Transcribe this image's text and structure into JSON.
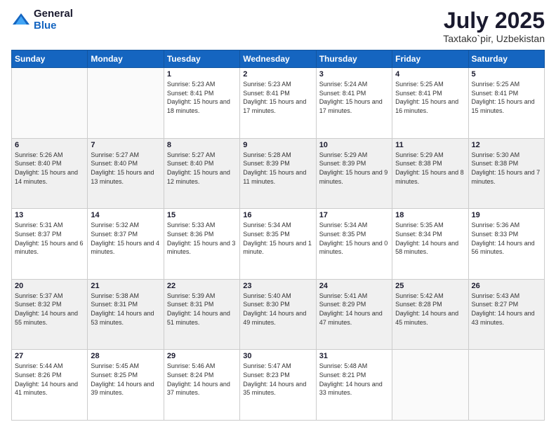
{
  "logo": {
    "general": "General",
    "blue": "Blue"
  },
  "title": "July 2025",
  "subtitle": "Taxtako`pir, Uzbekistan",
  "days_of_week": [
    "Sunday",
    "Monday",
    "Tuesday",
    "Wednesday",
    "Thursday",
    "Friday",
    "Saturday"
  ],
  "weeks": [
    [
      {
        "day": "",
        "sunrise": "",
        "sunset": "",
        "daylight": ""
      },
      {
        "day": "",
        "sunrise": "",
        "sunset": "",
        "daylight": ""
      },
      {
        "day": "1",
        "sunrise": "Sunrise: 5:23 AM",
        "sunset": "Sunset: 8:41 PM",
        "daylight": "Daylight: 15 hours and 18 minutes."
      },
      {
        "day": "2",
        "sunrise": "Sunrise: 5:23 AM",
        "sunset": "Sunset: 8:41 PM",
        "daylight": "Daylight: 15 hours and 17 minutes."
      },
      {
        "day": "3",
        "sunrise": "Sunrise: 5:24 AM",
        "sunset": "Sunset: 8:41 PM",
        "daylight": "Daylight: 15 hours and 17 minutes."
      },
      {
        "day": "4",
        "sunrise": "Sunrise: 5:25 AM",
        "sunset": "Sunset: 8:41 PM",
        "daylight": "Daylight: 15 hours and 16 minutes."
      },
      {
        "day": "5",
        "sunrise": "Sunrise: 5:25 AM",
        "sunset": "Sunset: 8:41 PM",
        "daylight": "Daylight: 15 hours and 15 minutes."
      }
    ],
    [
      {
        "day": "6",
        "sunrise": "Sunrise: 5:26 AM",
        "sunset": "Sunset: 8:40 PM",
        "daylight": "Daylight: 15 hours and 14 minutes."
      },
      {
        "day": "7",
        "sunrise": "Sunrise: 5:27 AM",
        "sunset": "Sunset: 8:40 PM",
        "daylight": "Daylight: 15 hours and 13 minutes."
      },
      {
        "day": "8",
        "sunrise": "Sunrise: 5:27 AM",
        "sunset": "Sunset: 8:40 PM",
        "daylight": "Daylight: 15 hours and 12 minutes."
      },
      {
        "day": "9",
        "sunrise": "Sunrise: 5:28 AM",
        "sunset": "Sunset: 8:39 PM",
        "daylight": "Daylight: 15 hours and 11 minutes."
      },
      {
        "day": "10",
        "sunrise": "Sunrise: 5:29 AM",
        "sunset": "Sunset: 8:39 PM",
        "daylight": "Daylight: 15 hours and 9 minutes."
      },
      {
        "day": "11",
        "sunrise": "Sunrise: 5:29 AM",
        "sunset": "Sunset: 8:38 PM",
        "daylight": "Daylight: 15 hours and 8 minutes."
      },
      {
        "day": "12",
        "sunrise": "Sunrise: 5:30 AM",
        "sunset": "Sunset: 8:38 PM",
        "daylight": "Daylight: 15 hours and 7 minutes."
      }
    ],
    [
      {
        "day": "13",
        "sunrise": "Sunrise: 5:31 AM",
        "sunset": "Sunset: 8:37 PM",
        "daylight": "Daylight: 15 hours and 6 minutes."
      },
      {
        "day": "14",
        "sunrise": "Sunrise: 5:32 AM",
        "sunset": "Sunset: 8:37 PM",
        "daylight": "Daylight: 15 hours and 4 minutes."
      },
      {
        "day": "15",
        "sunrise": "Sunrise: 5:33 AM",
        "sunset": "Sunset: 8:36 PM",
        "daylight": "Daylight: 15 hours and 3 minutes."
      },
      {
        "day": "16",
        "sunrise": "Sunrise: 5:34 AM",
        "sunset": "Sunset: 8:35 PM",
        "daylight": "Daylight: 15 hours and 1 minute."
      },
      {
        "day": "17",
        "sunrise": "Sunrise: 5:34 AM",
        "sunset": "Sunset: 8:35 PM",
        "daylight": "Daylight: 15 hours and 0 minutes."
      },
      {
        "day": "18",
        "sunrise": "Sunrise: 5:35 AM",
        "sunset": "Sunset: 8:34 PM",
        "daylight": "Daylight: 14 hours and 58 minutes."
      },
      {
        "day": "19",
        "sunrise": "Sunrise: 5:36 AM",
        "sunset": "Sunset: 8:33 PM",
        "daylight": "Daylight: 14 hours and 56 minutes."
      }
    ],
    [
      {
        "day": "20",
        "sunrise": "Sunrise: 5:37 AM",
        "sunset": "Sunset: 8:32 PM",
        "daylight": "Daylight: 14 hours and 55 minutes."
      },
      {
        "day": "21",
        "sunrise": "Sunrise: 5:38 AM",
        "sunset": "Sunset: 8:31 PM",
        "daylight": "Daylight: 14 hours and 53 minutes."
      },
      {
        "day": "22",
        "sunrise": "Sunrise: 5:39 AM",
        "sunset": "Sunset: 8:31 PM",
        "daylight": "Daylight: 14 hours and 51 minutes."
      },
      {
        "day": "23",
        "sunrise": "Sunrise: 5:40 AM",
        "sunset": "Sunset: 8:30 PM",
        "daylight": "Daylight: 14 hours and 49 minutes."
      },
      {
        "day": "24",
        "sunrise": "Sunrise: 5:41 AM",
        "sunset": "Sunset: 8:29 PM",
        "daylight": "Daylight: 14 hours and 47 minutes."
      },
      {
        "day": "25",
        "sunrise": "Sunrise: 5:42 AM",
        "sunset": "Sunset: 8:28 PM",
        "daylight": "Daylight: 14 hours and 45 minutes."
      },
      {
        "day": "26",
        "sunrise": "Sunrise: 5:43 AM",
        "sunset": "Sunset: 8:27 PM",
        "daylight": "Daylight: 14 hours and 43 minutes."
      }
    ],
    [
      {
        "day": "27",
        "sunrise": "Sunrise: 5:44 AM",
        "sunset": "Sunset: 8:26 PM",
        "daylight": "Daylight: 14 hours and 41 minutes."
      },
      {
        "day": "28",
        "sunrise": "Sunrise: 5:45 AM",
        "sunset": "Sunset: 8:25 PM",
        "daylight": "Daylight: 14 hours and 39 minutes."
      },
      {
        "day": "29",
        "sunrise": "Sunrise: 5:46 AM",
        "sunset": "Sunset: 8:24 PM",
        "daylight": "Daylight: 14 hours and 37 minutes."
      },
      {
        "day": "30",
        "sunrise": "Sunrise: 5:47 AM",
        "sunset": "Sunset: 8:23 PM",
        "daylight": "Daylight: 14 hours and 35 minutes."
      },
      {
        "day": "31",
        "sunrise": "Sunrise: 5:48 AM",
        "sunset": "Sunset: 8:21 PM",
        "daylight": "Daylight: 14 hours and 33 minutes."
      },
      {
        "day": "",
        "sunrise": "",
        "sunset": "",
        "daylight": ""
      },
      {
        "day": "",
        "sunrise": "",
        "sunset": "",
        "daylight": ""
      }
    ]
  ]
}
